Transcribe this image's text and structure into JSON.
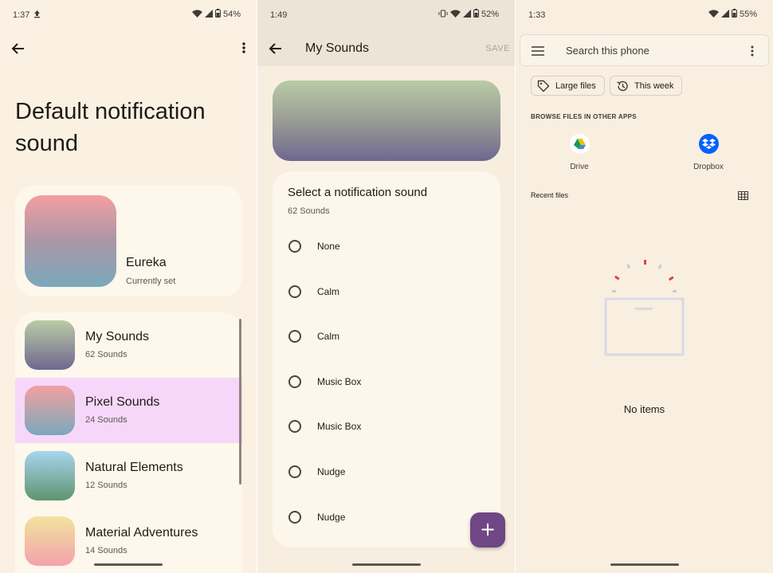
{
  "panel1": {
    "status": {
      "time": "1:37",
      "battery": "54%"
    },
    "title": "Default notification sound",
    "current": {
      "name": "Eureka",
      "subtitle": "Currently set"
    },
    "categories": [
      {
        "name": "My Sounds",
        "count": "62 Sounds",
        "selected": false,
        "gradient": [
          "#b9cca5",
          "#6f6790"
        ]
      },
      {
        "name": "Pixel Sounds",
        "count": "24 Sounds",
        "selected": true,
        "gradient": [
          "#f3a0a1",
          "#79a9bb"
        ]
      },
      {
        "name": "Natural Elements",
        "count": "12 Sounds",
        "selected": false,
        "gradient": [
          "#a8d5ef",
          "#5f946e"
        ]
      },
      {
        "name": "Material Adventures",
        "count": "14 Sounds",
        "selected": false,
        "gradient": [
          "#f2e39e",
          "#f3a2ab"
        ]
      }
    ]
  },
  "panel2": {
    "status": {
      "time": "1:49",
      "battery": "52%"
    },
    "title": "My Sounds",
    "save_label": "SAVE",
    "card_title": "Select a notification sound",
    "count": "62 Sounds",
    "options": [
      "None",
      "Calm",
      "Calm",
      "Music Box",
      "Music Box",
      "Nudge",
      "Nudge"
    ],
    "fab_label": "+"
  },
  "panel3": {
    "status": {
      "time": "1:33",
      "battery": "55%"
    },
    "search_placeholder": "Search this phone",
    "chips": [
      "Large files",
      "This week"
    ],
    "browse_heading": "BROWSE FILES IN OTHER APPS",
    "apps": [
      {
        "name": "Drive",
        "icon": "drive-icon"
      },
      {
        "name": "Dropbox",
        "icon": "dropbox-icon"
      }
    ],
    "recent_heading": "Recent files",
    "empty_text": "No items"
  },
  "colors": {
    "selected_row": "#f6d7fa",
    "fab": "#6e4784",
    "dropbox": "#0061fe"
  }
}
